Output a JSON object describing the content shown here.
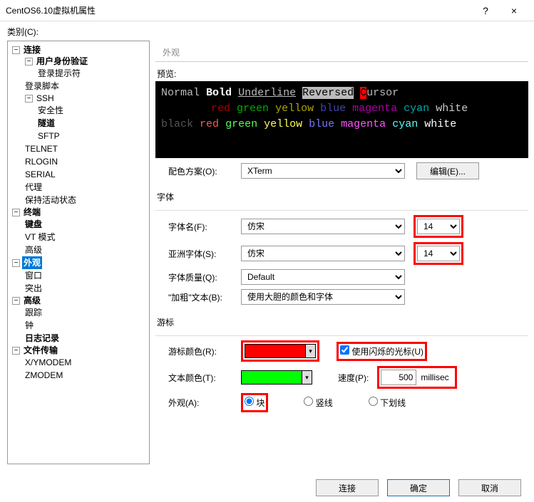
{
  "window": {
    "title": "CentOS6.10虚拟机属性",
    "help": "?",
    "close": "×"
  },
  "category_label": "类别(C):",
  "tree": {
    "connection": "连接",
    "user_auth": "用户身份验证",
    "login_prompt": "登录提示符",
    "login_script": "登录脚本",
    "ssh": "SSH",
    "security": "安全性",
    "tunnel": "隧道",
    "sftp": "SFTP",
    "telnet": "TELNET",
    "rlogin": "RLOGIN",
    "serial": "SERIAL",
    "proxy": "代理",
    "keep_alive": "保持活动状态",
    "terminal": "终端",
    "keyboard": "键盘",
    "vt_mode": "VT 模式",
    "advanced": "高级",
    "appearance": "外观",
    "window": "窗口",
    "highlight": "突出",
    "advanced2": "高级",
    "trace": "跟踪",
    "bell": "钟",
    "logging": "日志记录",
    "file_transfer": "文件传输",
    "xymodem": "X/YMODEM",
    "zmodem": "ZMODEM"
  },
  "tab": "外观",
  "preview": {
    "label": "预览:",
    "normal": "Normal",
    "bold": "Bold",
    "underline": "Underline",
    "reversed": "Reversed",
    "cursor_c": "C",
    "cursor_rest": "ursor",
    "red": "red",
    "green": "green",
    "yellow": "yellow",
    "blue": "blue",
    "magenta": "magenta",
    "cyan": "cyan",
    "white": "white",
    "black": "black"
  },
  "scheme": {
    "label": "配色方案(O):",
    "value": "XTerm",
    "edit": "编辑(E)..."
  },
  "font": {
    "group": "字体",
    "name_label": "字体名(F):",
    "name_value": "仿宋",
    "size1": "14",
    "asian_label": "亚洲字体(S):",
    "asian_value": "仿宋",
    "size2": "14",
    "quality_label": "字体质量(Q):",
    "quality_value": "Default",
    "bold_label": "\"加粗\"文本(B):",
    "bold_value": "使用大胆的颜色和字体"
  },
  "cursor": {
    "group": "游标",
    "color_label": "游标颜色(R):",
    "color_value": "#ff0000",
    "blink_label": "使用闪烁的光标(U)",
    "text_color_label": "文本颜色(T):",
    "text_color_value": "#00ff00",
    "speed_label": "速度(P):",
    "speed_value": "500",
    "speed_unit": "millisec",
    "appearance_label": "外观(A):",
    "block": "块",
    "vline": "竖线",
    "uline": "下划线"
  },
  "footer": {
    "connect": "连接",
    "ok": "确定",
    "cancel": "取消"
  }
}
